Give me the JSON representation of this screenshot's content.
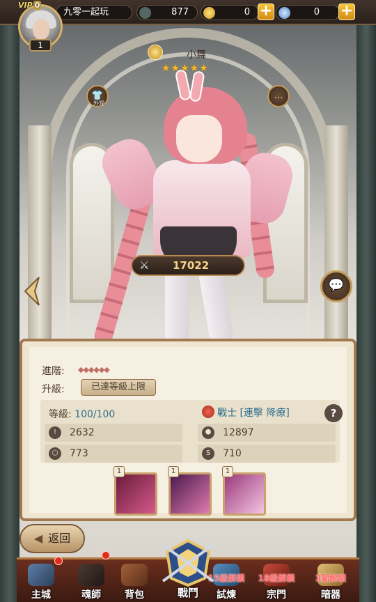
{
  "player": {
    "vip_label": "VIP",
    "vip_level": "0",
    "level": "1",
    "name": "九零一起玩"
  },
  "currency": {
    "swords": "877",
    "gold": "0",
    "potion": "0"
  },
  "hero": {
    "name": "小舞",
    "stars": "★★★★★",
    "power": "17022",
    "outfit_label": "外观"
  },
  "panel": {
    "advance_label": "進階:",
    "advance_chevrons": "◆◆◆◆◆◆",
    "upgrade_label": "升級:",
    "upgrade_button": "已達等級上限",
    "level_label": "等級:",
    "level_value": "100/100",
    "class_text": "戰士 [連擊 降療]",
    "help": "?",
    "stats": [
      "2632",
      "12897",
      "773",
      "710"
    ],
    "skill_levels": [
      "1",
      "1",
      "1"
    ]
  },
  "back_label": "返回",
  "nav": [
    {
      "label": "主城"
    },
    {
      "label": "魂師"
    },
    {
      "label": "背包"
    },
    {
      "label": "戰鬥"
    },
    {
      "label": "試煉",
      "lock": "15級解鎖"
    },
    {
      "label": "宗門",
      "lock": "18級解鎖"
    },
    {
      "label": "暗器",
      "lock": "3關解鎖"
    }
  ]
}
